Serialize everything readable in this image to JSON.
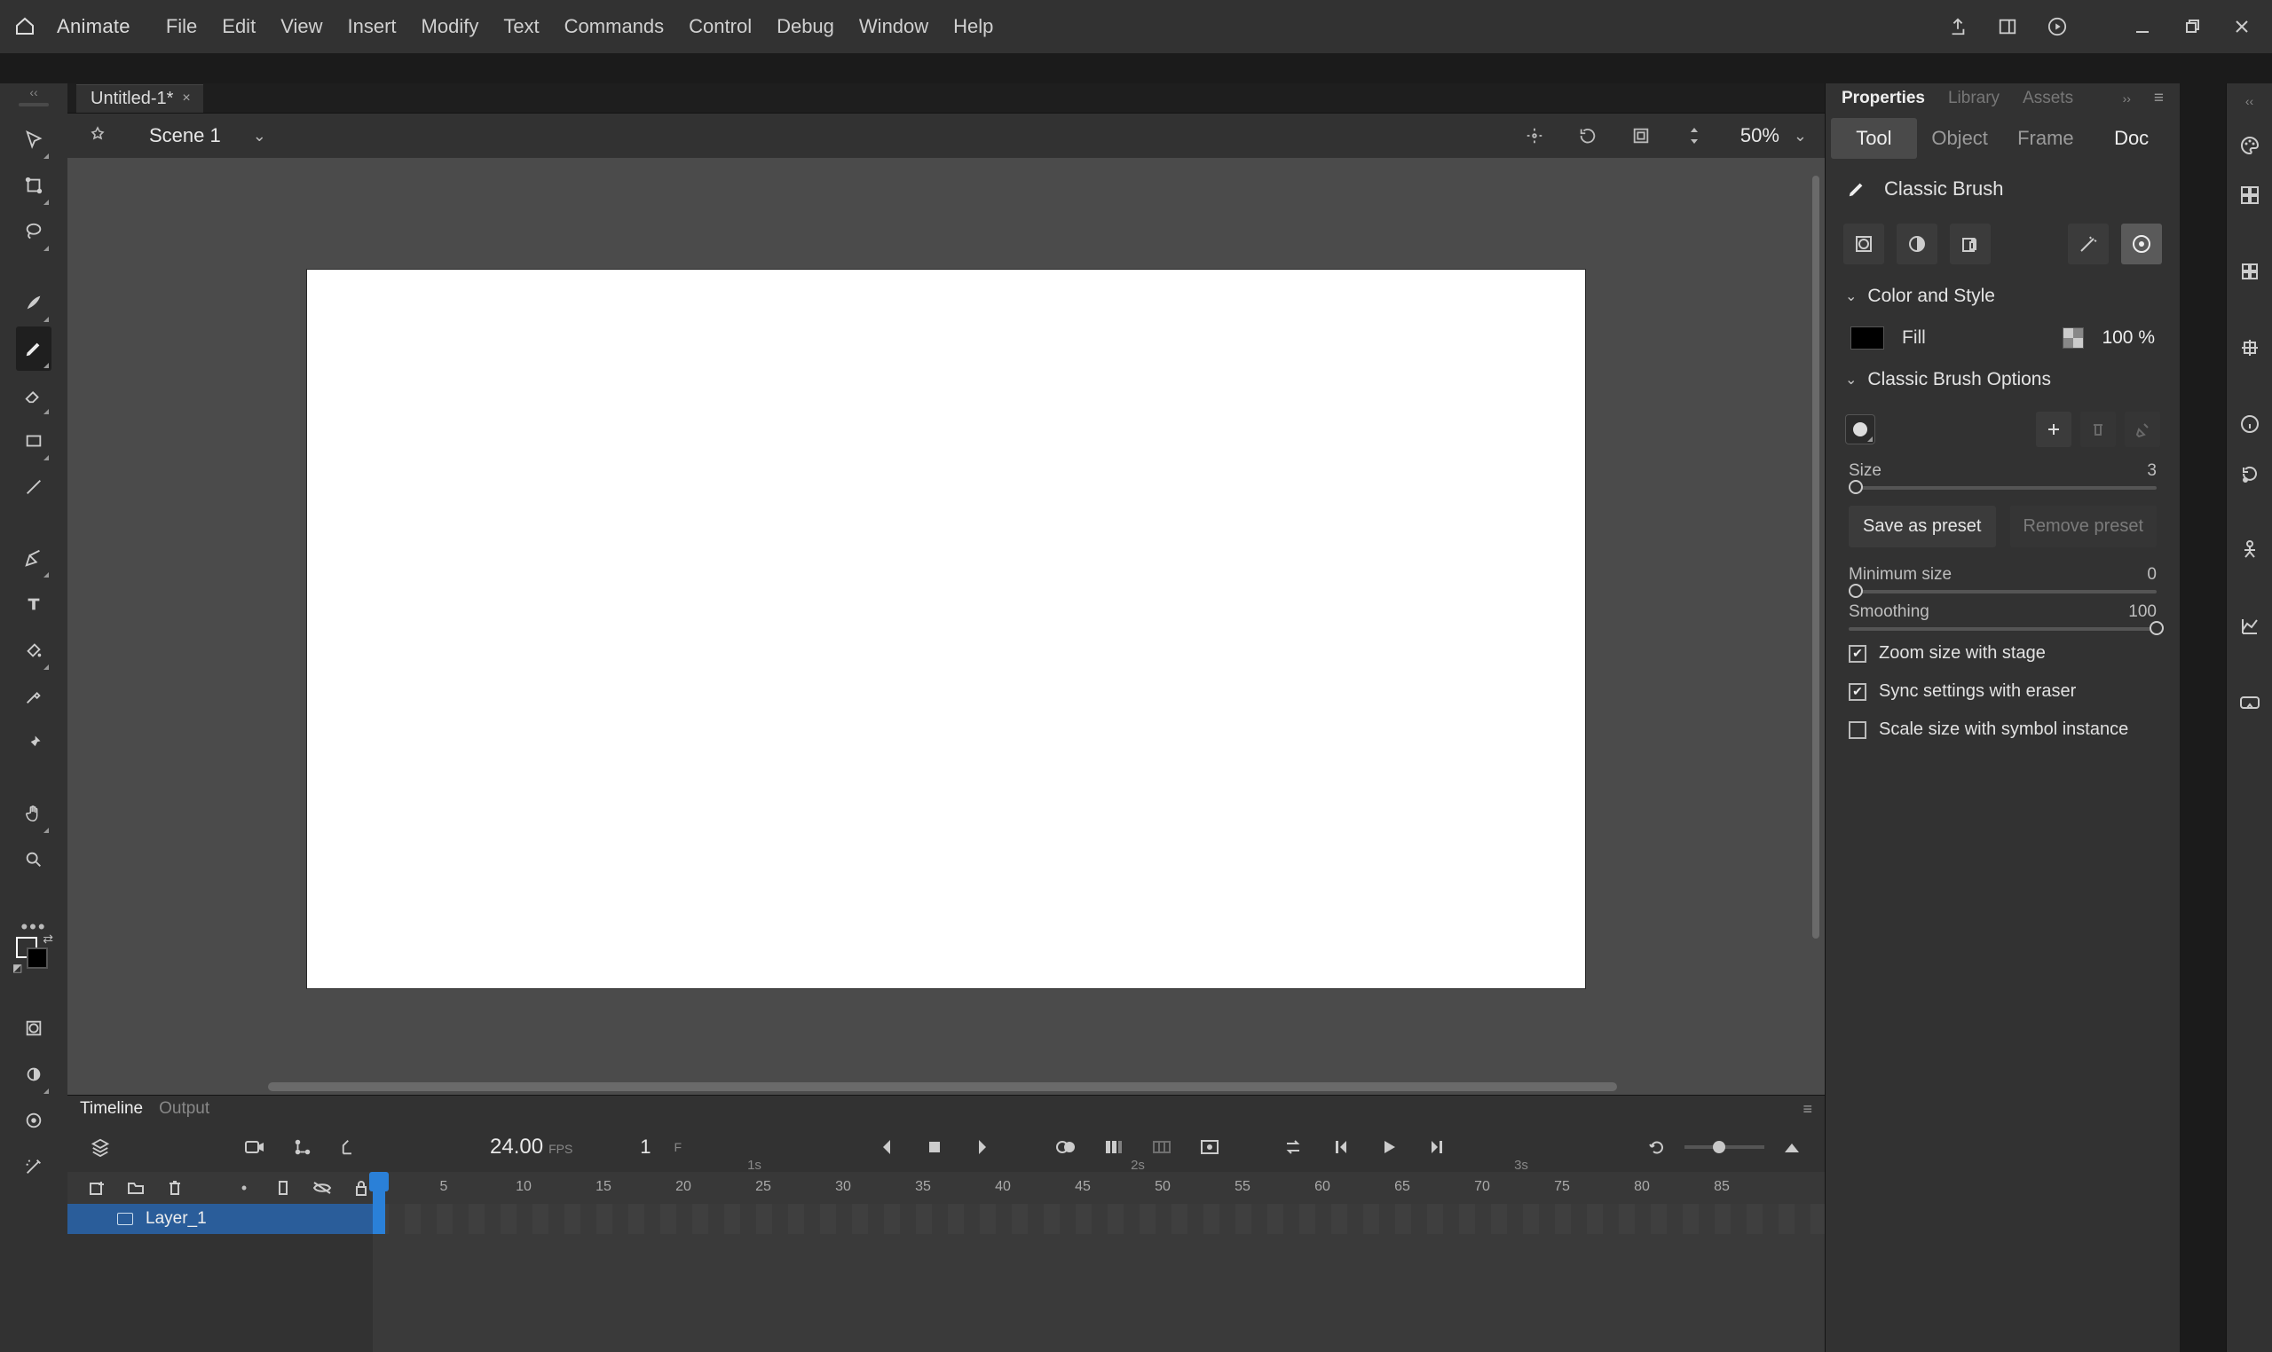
{
  "app": {
    "name": "Animate"
  },
  "menus": [
    "File",
    "Edit",
    "View",
    "Insert",
    "Modify",
    "Text",
    "Commands",
    "Control",
    "Debug",
    "Window",
    "Help"
  ],
  "doc_tab": {
    "title": "Untitled-1*",
    "close": "×"
  },
  "scene": {
    "name": "Scene 1",
    "zoom": "50%"
  },
  "left_tools": [
    {
      "name": "selection-tool",
      "active": false
    },
    {
      "name": "free-transform-tool",
      "active": false
    },
    {
      "name": "lasso-tool",
      "active": false
    },
    {
      "name": "fluid-brush-tool",
      "active": false
    },
    {
      "name": "classic-brush-tool",
      "active": true
    },
    {
      "name": "eraser-tool",
      "active": false
    },
    {
      "name": "rectangle-tool",
      "active": false
    },
    {
      "name": "line-tool",
      "active": false
    },
    {
      "name": "pen-tool",
      "active": false
    },
    {
      "name": "text-tool",
      "active": false
    },
    {
      "name": "paint-bucket-tool",
      "active": false
    },
    {
      "name": "eyedropper-tool",
      "active": false
    },
    {
      "name": "pin-tool",
      "active": false
    },
    {
      "name": "hand-tool",
      "active": false
    },
    {
      "name": "zoom-tool",
      "active": false
    }
  ],
  "timeline": {
    "tab_timeline": "Timeline",
    "tab_output": "Output",
    "fps": "24.00",
    "fps_label": "FPS",
    "current_frame": "1",
    "frame_label": "F",
    "layer_name": "Layer_1",
    "ruler_ticks": [
      5,
      10,
      15,
      20,
      25,
      30,
      35,
      40,
      45,
      50,
      55,
      60,
      65,
      70,
      75,
      80,
      85
    ],
    "seconds": [
      "1s",
      "2s",
      "3s"
    ]
  },
  "properties": {
    "panel_tabs": [
      "Properties",
      "Library",
      "Assets"
    ],
    "mode_tabs": [
      "Tool",
      "Object",
      "Frame",
      "Doc"
    ],
    "tool_name": "Classic Brush",
    "section_color": "Color and Style",
    "fill_label": "Fill",
    "fill_alpha": "100 %",
    "section_brush": "Classic Brush Options",
    "size_label": "Size",
    "size_val": "3",
    "save_preset": "Save as preset",
    "remove_preset": "Remove preset",
    "min_label": "Minimum size",
    "min_val": "0",
    "smooth_label": "Smoothing",
    "smooth_val": "100",
    "chk_zoom": "Zoom size with stage",
    "chk_sync": "Sync settings with eraser",
    "chk_scale": "Scale size with symbol instance"
  }
}
